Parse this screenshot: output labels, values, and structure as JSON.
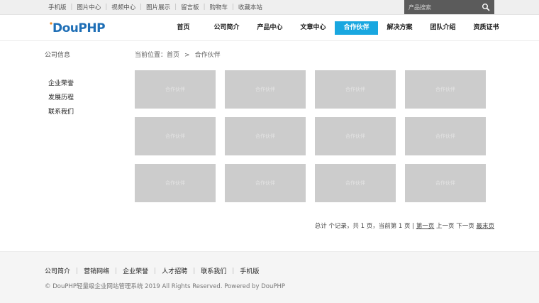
{
  "topbar": {
    "links": [
      "手机版",
      "图片中心",
      "视频中心",
      "图片展示",
      "留言板",
      "购物车",
      "收藏本站"
    ],
    "search_placeholder": "产品搜索"
  },
  "header": {
    "logo_text": "DouPHP",
    "nav": [
      "首页",
      "公司简介",
      "产品中心",
      "文章中心",
      "合作伙伴",
      "解决方案",
      "团队介绍",
      "资质证书"
    ],
    "active": "合作伙伴"
  },
  "sidebar": {
    "title": "公司信息",
    "items": [
      "企业荣誉",
      "发展历程",
      "联系我们"
    ]
  },
  "breadcrumb": {
    "prefix": "当前位置：",
    "home": "首页",
    "separator": ">",
    "current": "合作伙伴"
  },
  "tiles": [
    "合作伙伴",
    "合作伙伴",
    "合作伙伴",
    "合作伙伴",
    "合作伙伴",
    "合作伙伴",
    "合作伙伴",
    "合作伙伴",
    "合作伙伴",
    "合作伙伴",
    "合作伙伴",
    "合作伙伴"
  ],
  "pager": {
    "summary": "总计 个记录，共 1 页，当前第 1 页 |",
    "first": "第一页",
    "prev": "上一页",
    "next": "下一页",
    "last": "最末页"
  },
  "footer": {
    "links": [
      "公司简介",
      "营销网络",
      "企业荣誉",
      "人才招聘",
      "联系我们",
      "手机版"
    ],
    "copyright": "© DouPHP轻量级企业网站管理系统 2019 All Rights Reserved. Powered by DouPHP"
  },
  "colors": {
    "accent": "#19a7e0",
    "logo": "#1f6fb6",
    "tile": "#cccccc",
    "search_bg": "#5b5b5b"
  }
}
